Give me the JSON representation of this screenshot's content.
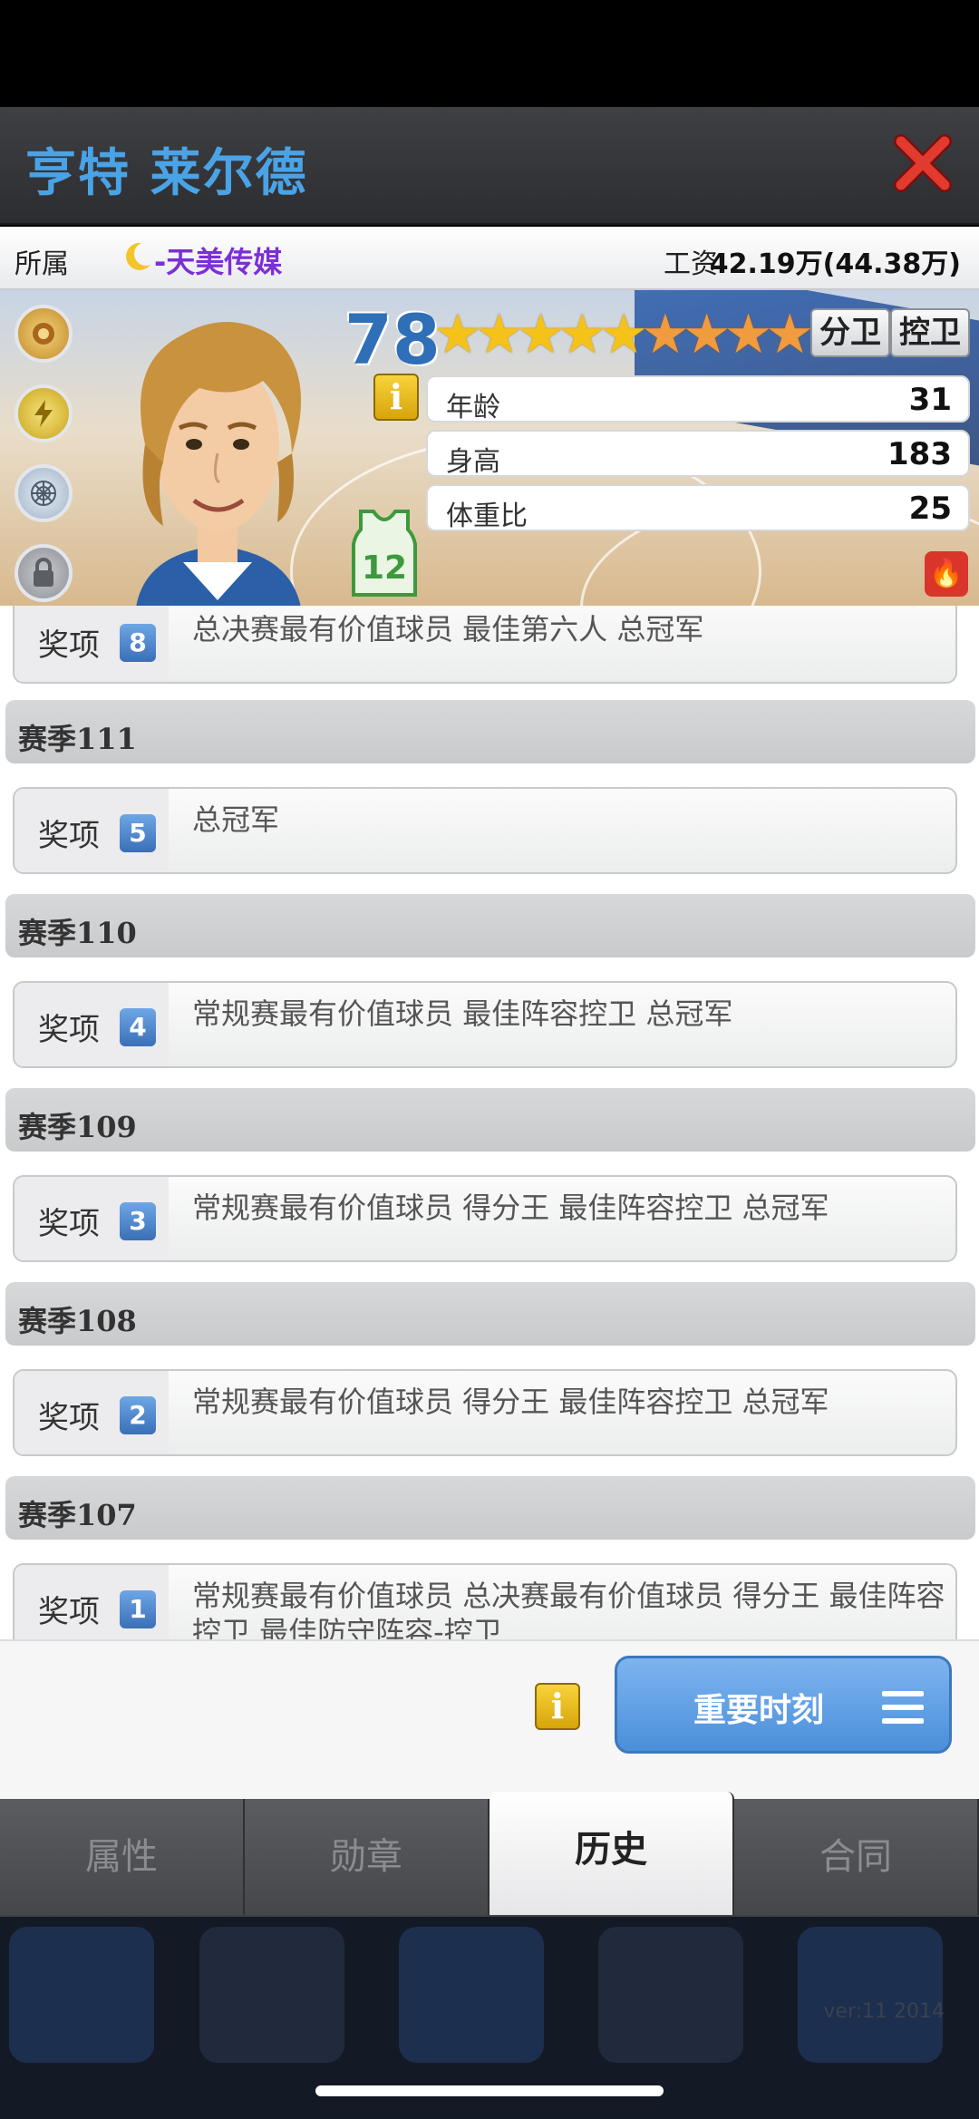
{
  "header": {
    "title": "亨特 莱尔德"
  },
  "info": {
    "team_label": "所属",
    "team_name": "-天美传媒",
    "salary_label": "工资",
    "salary_value": "42.19万(44.38万)"
  },
  "player": {
    "overall": "78",
    "stars": {
      "total": 9,
      "gold": 5,
      "orange": 4
    },
    "positions": [
      "分卫",
      "控卫"
    ],
    "info_icon": "i",
    "jersey_number": "12",
    "stats": [
      {
        "label": "年龄",
        "value": "31"
      },
      {
        "label": "身高",
        "value": "183"
      },
      {
        "label": "体重比",
        "value": "25"
      }
    ]
  },
  "history": {
    "partial_award": {
      "label": "奖项",
      "count": "8",
      "desc": "总决赛最有价值球员  最佳第六人  总冠军"
    },
    "seasons": [
      {
        "title": "赛季111",
        "award_label": "奖项",
        "count": "5",
        "desc": "总冠军"
      },
      {
        "title": "赛季110",
        "award_label": "奖项",
        "count": "4",
        "desc": "常规赛最有价值球员  最佳阵容控卫  总冠军"
      },
      {
        "title": "赛季109",
        "award_label": "奖项",
        "count": "3",
        "desc": "常规赛最有价值球员  得分王  最佳阵容控卫  总冠军"
      },
      {
        "title": "赛季108",
        "award_label": "奖项",
        "count": "2",
        "desc": "常规赛最有价值球员  得分王  最佳阵容控卫  总冠军"
      },
      {
        "title": "赛季107",
        "award_label": "奖项",
        "count": "1",
        "desc": "常规赛最有价值球员  总决赛最有价值球员  得分王  最佳阵容控卫  最佳防守阵容-控卫"
      }
    ]
  },
  "actions": {
    "info_icon": "i",
    "main_button": "重要时刻"
  },
  "tabs": [
    "属性",
    "勋章",
    "历史",
    "合同"
  ],
  "active_tab": "历史",
  "footer": {
    "version": "ver:11  2014"
  },
  "colors": {
    "accent": "#4aa3e6",
    "team": "#7b2fd6",
    "button": "#4a8fdb"
  }
}
